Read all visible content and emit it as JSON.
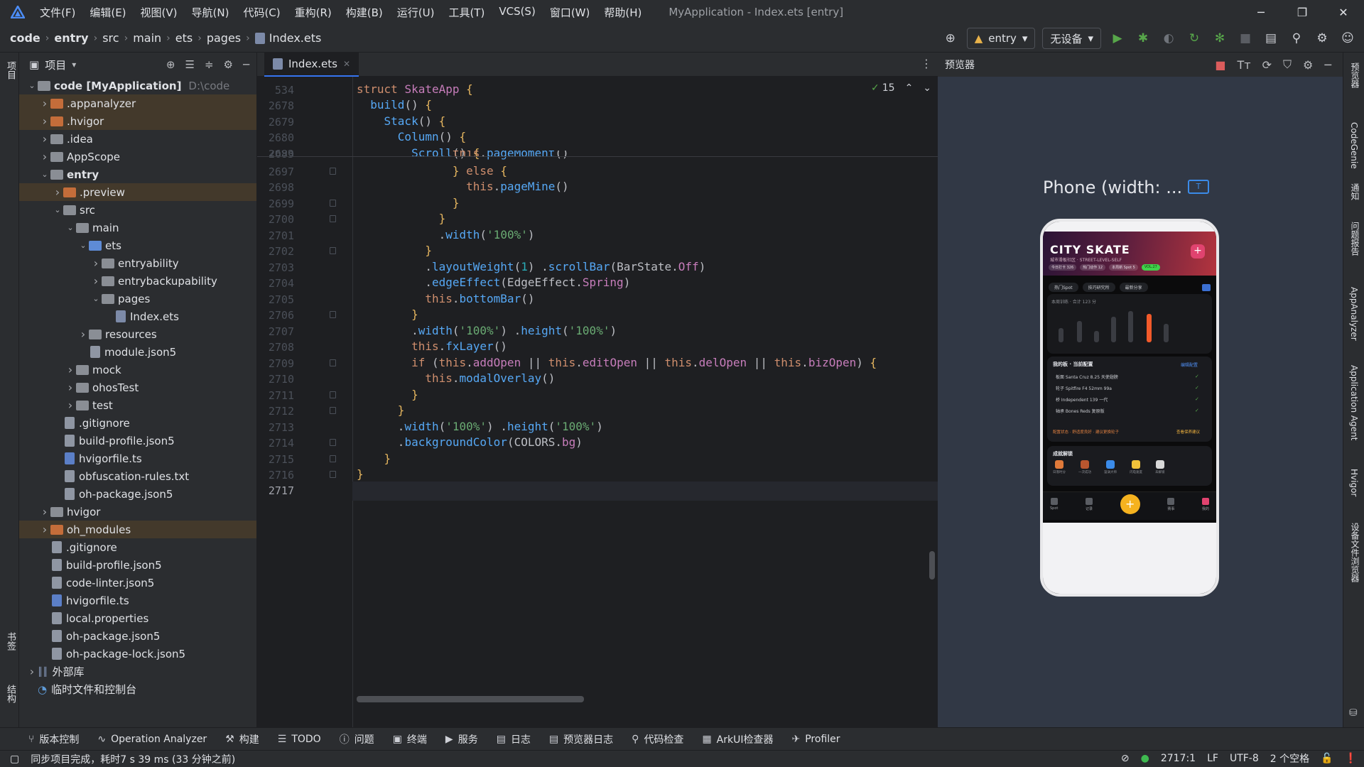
{
  "menubar": {
    "items": [
      "文件(F)",
      "编辑(E)",
      "视图(V)",
      "导航(N)",
      "代码(C)",
      "重构(R)",
      "构建(B)",
      "运行(U)",
      "工具(T)",
      "VCS(S)",
      "窗口(W)",
      "帮助(H)"
    ],
    "window_title": "MyApplication - Index.ets [entry]"
  },
  "breadcrumb": [
    "code",
    "entry",
    "src",
    "main",
    "ets",
    "pages",
    "Index.ets"
  ],
  "toolbar": {
    "module": "entry",
    "device": "无设备"
  },
  "left_strip": {
    "top": "项目",
    "mid": "书签",
    "bottom": "结构"
  },
  "project": {
    "title": "项目",
    "tree": [
      {
        "label": "code [MyApplication]",
        "extra": "D:\\code",
        "depth": 0,
        "arrow": "v",
        "kind": "folder",
        "bold": true
      },
      {
        "label": ".appanalyzer",
        "depth": 1,
        "arrow": ">",
        "kind": "folder-orange",
        "hl": true
      },
      {
        "label": ".hvigor",
        "depth": 1,
        "arrow": ">",
        "kind": "folder-orange",
        "hl": true
      },
      {
        "label": ".idea",
        "depth": 1,
        "arrow": ">",
        "kind": "folder"
      },
      {
        "label": "AppScope",
        "depth": 1,
        "arrow": ">",
        "kind": "folder"
      },
      {
        "label": "entry",
        "depth": 1,
        "arrow": "v",
        "kind": "folder",
        "bold": true
      },
      {
        "label": ".preview",
        "depth": 2,
        "arrow": ">",
        "kind": "folder-orange",
        "hl": true
      },
      {
        "label": "src",
        "depth": 2,
        "arrow": "v",
        "kind": "folder"
      },
      {
        "label": "main",
        "depth": 3,
        "arrow": "v",
        "kind": "folder"
      },
      {
        "label": "ets",
        "depth": 4,
        "arrow": "v",
        "kind": "folder-blue"
      },
      {
        "label": "entryability",
        "depth": 5,
        "arrow": ">",
        "kind": "folder"
      },
      {
        "label": "entrybackupability",
        "depth": 5,
        "arrow": ">",
        "kind": "folder"
      },
      {
        "label": "pages",
        "depth": 5,
        "arrow": "v",
        "kind": "folder"
      },
      {
        "label": "Index.ets",
        "depth": 6,
        "arrow": "",
        "kind": "file-ets"
      },
      {
        "label": "resources",
        "depth": 4,
        "arrow": ">",
        "kind": "folder"
      },
      {
        "label": "module.json5",
        "depth": 4,
        "arrow": "",
        "kind": "file"
      },
      {
        "label": "mock",
        "depth": 3,
        "arrow": ">",
        "kind": "folder"
      },
      {
        "label": "ohosTest",
        "depth": 3,
        "arrow": ">",
        "kind": "folder"
      },
      {
        "label": "test",
        "depth": 3,
        "arrow": ">",
        "kind": "folder"
      },
      {
        "label": ".gitignore",
        "depth": 2,
        "arrow": "",
        "kind": "file"
      },
      {
        "label": "build-profile.json5",
        "depth": 2,
        "arrow": "",
        "kind": "file"
      },
      {
        "label": "hvigorfile.ts",
        "depth": 2,
        "arrow": "",
        "kind": "file-ts"
      },
      {
        "label": "obfuscation-rules.txt",
        "depth": 2,
        "arrow": "",
        "kind": "file"
      },
      {
        "label": "oh-package.json5",
        "depth": 2,
        "arrow": "",
        "kind": "file"
      },
      {
        "label": "hvigor",
        "depth": 1,
        "arrow": ">",
        "kind": "folder"
      },
      {
        "label": "oh_modules",
        "depth": 1,
        "arrow": ">",
        "kind": "folder-orange",
        "hl": true
      },
      {
        "label": ".gitignore",
        "depth": 1,
        "arrow": "",
        "kind": "file"
      },
      {
        "label": "build-profile.json5",
        "depth": 1,
        "arrow": "",
        "kind": "file"
      },
      {
        "label": "code-linter.json5",
        "depth": 1,
        "arrow": "",
        "kind": "file"
      },
      {
        "label": "hvigorfile.ts",
        "depth": 1,
        "arrow": "",
        "kind": "file-ts"
      },
      {
        "label": "local.properties",
        "depth": 1,
        "arrow": "",
        "kind": "file"
      },
      {
        "label": "oh-package.json5",
        "depth": 1,
        "arrow": "",
        "kind": "file"
      },
      {
        "label": "oh-package-lock.json5",
        "depth": 1,
        "arrow": "",
        "kind": "file"
      },
      {
        "label": "外部库",
        "depth": 0,
        "arrow": ">",
        "kind": "lib"
      },
      {
        "label": "临时文件和控制台",
        "depth": 0,
        "arrow": "",
        "kind": "scratch"
      }
    ]
  },
  "editor": {
    "tab": "Index.ets",
    "inspection_count": "15",
    "lines": [
      {
        "n": "534",
        "html": "<span class='kw'>struct</span> <span class='mt'>SkateApp</span> <span class='br'>{</span>"
      },
      {
        "n": "2678",
        "html": "  <span class='fn'>build</span>() <span class='br'>{</span>"
      },
      {
        "n": "2679",
        "html": "    <span class='fn'>Stack</span>() <span class='br'>{</span>"
      },
      {
        "n": "2680",
        "html": "      <span class='fn'>Column</span>() <span class='br'>{</span>"
      },
      {
        "n": "2683",
        "html": "        <span class='fn'>Scroll</span>() <span class='br'>{</span>"
      },
      {
        "n": "2697",
        "html": "              <span class='br'>}</span> <span class='kw'>else</span> <span class='br'>{</span>"
      },
      {
        "n": "2698",
        "html": "                <span class='kw'>this</span>.<span class='fn'>pageMine</span>()"
      },
      {
        "n": "2699",
        "html": "              <span class='br'>}</span>"
      },
      {
        "n": "2700",
        "html": "            <span class='br'>}</span>"
      },
      {
        "n": "2701",
        "html": "            .<span class='fn'>width</span>(<span class='st'>'100%'</span>)"
      },
      {
        "n": "2702",
        "html": "          <span class='br'>}</span>"
      },
      {
        "n": "2703",
        "html": "          .<span class='fn'>layoutWeight</span>(<span class='nu'>1</span>) .<span class='fn'>scrollBar</span>(BarState.<span class='mt'>Off</span>)"
      },
      {
        "n": "2704",
        "html": "          .<span class='fn'>edgeEffect</span>(EdgeEffect.<span class='mt'>Spring</span>)"
      },
      {
        "n": "2705",
        "html": "          <span class='kw'>this</span>.<span class='fn'>bottomBar</span>()"
      },
      {
        "n": "2706",
        "html": "        <span class='br'>}</span>"
      },
      {
        "n": "2707",
        "html": "        .<span class='fn'>width</span>(<span class='st'>'100%'</span>) .<span class='fn'>height</span>(<span class='st'>'100%'</span>)"
      },
      {
        "n": "2708",
        "html": "        <span class='kw'>this</span>.<span class='fn'>fxLayer</span>()"
      },
      {
        "n": "2709",
        "html": "        <span class='kw'>if</span> (<span class='kw'>this</span>.<span class='mt'>addOpen</span> || <span class='kw'>this</span>.<span class='mt'>editOpen</span> || <span class='kw'>this</span>.<span class='mt'>delOpen</span> || <span class='kw'>this</span>.<span class='mt'>bizOpen</span>) <span class='br'>{</span>"
      },
      {
        "n": "2710",
        "html": "          <span class='kw'>this</span>.<span class='fn'>modalOverlay</span>()"
      },
      {
        "n": "2711",
        "html": "        <span class='br'>}</span>"
      },
      {
        "n": "2712",
        "html": "      <span class='br'>}</span>"
      },
      {
        "n": "2713",
        "html": "      .<span class='fn'>width</span>(<span class='st'>'100%'</span>) .<span class='fn'>height</span>(<span class='st'>'100%'</span>)"
      },
      {
        "n": "2714",
        "html": "      .<span class='fn'>backgroundColor</span>(COLORS.<span class='mt'>bg</span>)"
      },
      {
        "n": "2715",
        "html": "    <span class='br'>}</span>"
      },
      {
        "n": "2716",
        "html": "<span class='br'>}</span>"
      },
      {
        "n": "2717",
        "html": ""
      }
    ]
  },
  "preview": {
    "title": "预览器",
    "device_label": "Phone (width: ...",
    "phone": {
      "app_title": "CITY SKATE",
      "subtitle": "城市滑板社区 · STREET-LEVEL-SELF",
      "chips": [
        "今日打卡 326",
        "热门动作 12",
        "本周新 Spot 5",
        "VOL.27"
      ],
      "tabs": [
        "热门Spot",
        "技巧研究所",
        "最新分享"
      ],
      "chart_label": "本周训练 · 合计 123 分",
      "section2_title": "我的板 · 当前配置",
      "section2_link": "编辑配置",
      "gear": [
        "板面 Santa Cruz 8.25 天使翅膀",
        "轮子 Spitfire F4 52mm 99a",
        "桥 Independent 139 一代",
        "轴承 Bones Reds 复原版"
      ],
      "gear_footer_left": "配置状态 · 舒适度良好 · 建议更换轮子",
      "gear_footer_right": "查看保养建议",
      "section3_title": "成就解锁",
      "achievements": [
        "日落时分",
        "一次成功",
        "漩涡大师",
        "闪电速度",
        "未解锁"
      ],
      "nav": [
        "Spot",
        "记录",
        "",
        "赛事",
        "我的"
      ]
    }
  },
  "right_strip": [
    "预览器",
    "CodeGenie",
    "通知",
    "问题报告",
    "AppAnalyzer",
    "Application Agent",
    "Hvigor",
    "设备文件浏览器"
  ],
  "toolwindows": [
    "版本控制",
    "Operation Analyzer",
    "构建",
    "TODO",
    "问题",
    "终端",
    "服务",
    "日志",
    "预览器日志",
    "代码检查",
    "ArkUI检查器",
    "Profiler"
  ],
  "status": {
    "message": "同步项目完成，耗时7 s 39 ms (33 分钟之前)",
    "position": "2717:1",
    "line_sep": "LF",
    "encoding": "UTF-8",
    "indent": "2 个空格"
  }
}
